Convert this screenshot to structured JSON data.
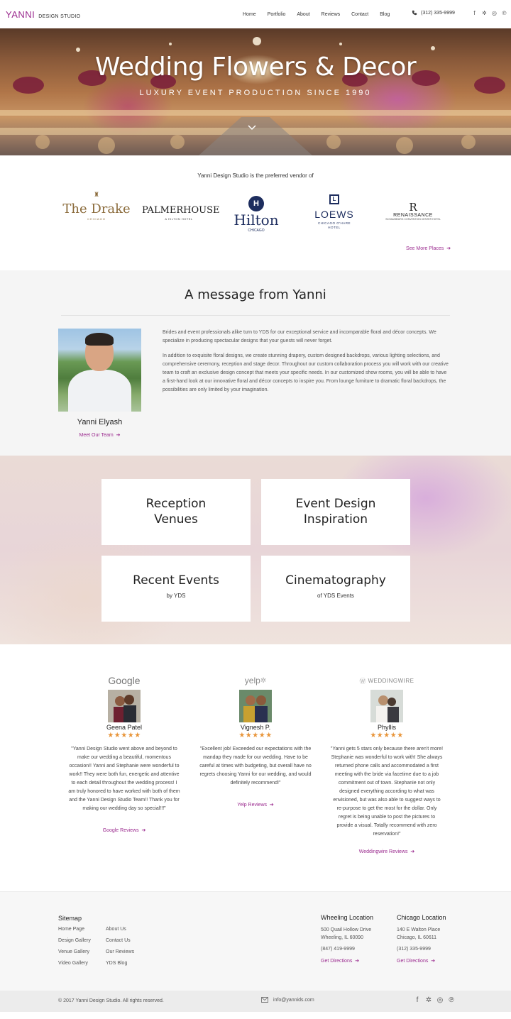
{
  "nav": {
    "logo_main": "YANNI",
    "logo_sub": "DESIGN STUDIO",
    "items": [
      "Home",
      "Portfolio",
      "About",
      "Reviews",
      "Contact",
      "Blog"
    ],
    "phone": "(312) 335-9999",
    "social_icons": [
      "facebook-icon",
      "yelp-icon",
      "instagram-icon",
      "pinterest-icon"
    ]
  },
  "hero": {
    "title": "Wedding Flowers & Decor",
    "subtitle": "LUXURY EVENT PRODUCTION SINCE 1990"
  },
  "vendors": {
    "intro": "Yanni Design Studio is the preferred vendor of",
    "logos": [
      {
        "name": "The Drake",
        "sub": "CHICAGO"
      },
      {
        "name": "PALMERHOUSE",
        "sub": "A HILTON HOTEL"
      },
      {
        "name": "Hilton",
        "sub": "CHICAGO"
      },
      {
        "name": "LOEWS",
        "sub": "CHICAGO O'HARE HOTEL"
      },
      {
        "name": "RENAISSANCE",
        "sub": "SCHAUMBURG CONVENTION CENTER HOTEL"
      }
    ],
    "see_more": "See More Places"
  },
  "message": {
    "title": "A message from Yanni",
    "person_name": "Yanni Elyash",
    "team_link": "Meet Our Team",
    "paragraph1": "Brides and event professionals alike turn to YDS for our exceptional service and incomparable floral and décor concepts. We specialize in producing spectacular designs that your guests will never forget.",
    "paragraph2": "In addition to exquisite floral designs, we create stunning drapery, custom designed backdrops, various lighting selections, and comprehensive ceremony, reception and stage decor. Throughout our custom collaboration process you will work with our creative team to craft an exclusive design concept that meets your specific needs. In our customized show rooms, you will be able to have a first-hand look at our innovative floral and décor concepts to inspire you. From lounge furniture to dramatic floral backdrops, the possibilities are only limited by your imagination."
  },
  "tiles": [
    {
      "line1": "Reception",
      "line2": "Venues",
      "sub": ""
    },
    {
      "line1": "Event Design",
      "line2": "Inspiration",
      "sub": ""
    },
    {
      "line1": "Recent Events",
      "line2": "",
      "sub": "by YDS"
    },
    {
      "line1": "Cinematography",
      "line2": "",
      "sub": "of YDS Events"
    }
  ],
  "reviews": [
    {
      "source": "Google",
      "name": "Geena Patel",
      "stars": "★★★★★",
      "rating": 5,
      "text": "\"Yanni Design Studio went above and beyond to make our wedding a beautiful, momentous occasion!! Yanni and Stephanie were wonderful to work!! They were both fun, energetic and attentive to each detail throughout the wedding process! I am truly honored to have worked with both of them and the Yanni Design Studio Team!! Thank you for making our wedding day so special!!!\"",
      "link": "Google Reviews"
    },
    {
      "source": "yelp",
      "name": "Vignesh P.",
      "stars": "★★★★★",
      "rating": 5,
      "text": "\"Excellent job! Exceeded our expectations with the mandap they made for our wedding. Have to be careful at times with budgeting, but overall have no regrets choosing Yanni for our wedding, and would definitely recommend!\"",
      "link": "Yelp Reviews"
    },
    {
      "source": "WEDDINGWIRE",
      "name": "Phyllis",
      "stars": "★★★★★",
      "rating": 5,
      "text": "\"Yanni gets 5 stars only because there aren't more! Stephanie was wonderful to work with! She always returned phone calls and accommodated a first meeting with the bride via facetime due to a job commitment out of town. Stephanie not only designed everything according to what was envisioned, but was also able to suggest ways to re-purpose to get the most for the dollar. Only regret is being unable to post the pictures to provide a visual. Totally recommend with zero reservation!\"",
      "link": "Weddingwire Reviews"
    }
  ],
  "footer": {
    "sitemap_title": "Sitemap",
    "sitemap_col1": [
      "Home Page",
      "Design Gallery",
      "Venue Gallery",
      "Video Gallery"
    ],
    "sitemap_col2": [
      "About Us",
      "Contact Us",
      "Our Reviews",
      "YDS Blog"
    ],
    "wheeling": {
      "title": "Wheeling Location",
      "address1": "500 Quail Hollow Drive",
      "address2": "Wheeling, IL 60090",
      "phone": "(847) 419-9999",
      "directions": "Get Directions"
    },
    "chicago": {
      "title": "Chicago Location",
      "address1": "140 E Walton Place",
      "address2": "Chicago, IL 60611",
      "phone": "(312) 335-9999",
      "directions": "Get Directions"
    },
    "copyright": "© 2017 Yanni Design Studio. All rights reserved.",
    "email": "info@yannids.com"
  },
  "colors": {
    "accent": "#9b2b8f",
    "star": "#e8953a",
    "panel_bg": "#f5f5f5"
  }
}
